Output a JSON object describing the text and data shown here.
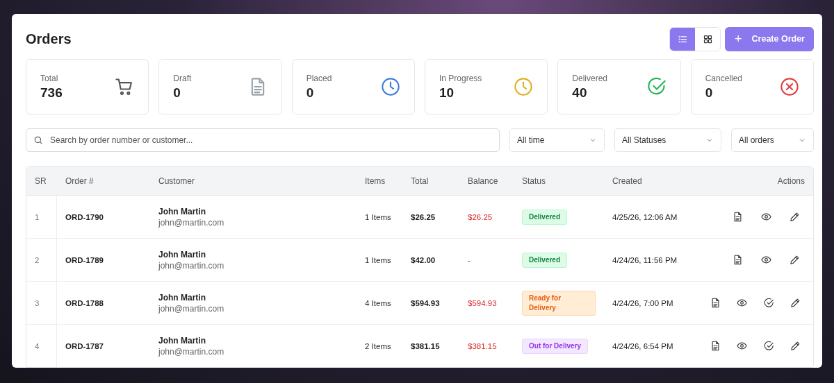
{
  "title": "Orders",
  "view_toggle": [
    {
      "kind": "list",
      "selected": true
    },
    {
      "kind": "grid",
      "selected": false
    }
  ],
  "create_button": {
    "icon": "+",
    "label": "Create Order"
  },
  "stats": [
    {
      "label": "Total",
      "value": "736",
      "kind": "cart",
      "color": "#555555"
    },
    {
      "label": "Draft",
      "value": "0",
      "kind": "document",
      "color": "#9aa0a8"
    },
    {
      "label": "Placed",
      "value": "0",
      "kind": "clock",
      "color": "#3b7ddd"
    },
    {
      "label": "In Progress",
      "value": "10",
      "kind": "clock",
      "color": "#e0b020"
    },
    {
      "label": "Delivered",
      "value": "40",
      "kind": "check",
      "color": "#22b45a"
    },
    {
      "label": "Cancelled",
      "value": "0",
      "kind": "cancel",
      "color": "#e04040"
    }
  ],
  "search": {
    "placeholder": "Search by order number or customer..."
  },
  "filters": [
    {
      "value": "All time"
    },
    {
      "value": "All Statuses"
    },
    {
      "value": "All orders"
    }
  ],
  "table": {
    "columns": [
      "SR",
      "Order #",
      "Customer",
      "Items",
      "Total",
      "Balance",
      "Status",
      "Created",
      "Actions"
    ],
    "rows": [
      {
        "sr": "1",
        "order": "ORD-1790",
        "name": "John Martin",
        "email": "john@martin.com",
        "items": "1 Items",
        "total": "$26.25",
        "balance": "$26.25",
        "outstanding": true,
        "status": {
          "label": "Delivered",
          "kind": "delivered"
        },
        "created": "4/25/26, 12:06 AM",
        "actions": [
          {
            "kind": "document"
          },
          {
            "kind": "view"
          },
          {
            "kind": "edit"
          }
        ]
      },
      {
        "sr": "2",
        "order": "ORD-1789",
        "name": "John Martin",
        "email": "john@martin.com",
        "items": "1 Items",
        "total": "$42.00",
        "balance": "-",
        "outstanding": false,
        "status": {
          "label": "Delivered",
          "kind": "delivered"
        },
        "created": "4/24/26, 11:56 PM",
        "actions": [
          {
            "kind": "document"
          },
          {
            "kind": "view"
          },
          {
            "kind": "edit"
          }
        ]
      },
      {
        "sr": "3",
        "order": "ORD-1788",
        "name": "John Martin",
        "email": "john@martin.com",
        "items": "4 Items",
        "total": "$594.93",
        "balance": "$594.93",
        "outstanding": true,
        "status": {
          "label": "Ready for Delivery",
          "kind": "ready"
        },
        "created": "4/24/26, 7:00 PM",
        "actions": [
          {
            "kind": "document"
          },
          {
            "kind": "view"
          },
          {
            "kind": "approve"
          },
          {
            "kind": "edit"
          }
        ]
      },
      {
        "sr": "4",
        "order": "ORD-1787",
        "name": "John Martin",
        "email": "john@martin.com",
        "items": "2 Items",
        "total": "$381.15",
        "balance": "$381.15",
        "outstanding": true,
        "status": {
          "label": "Out for Delivery",
          "kind": "out"
        },
        "created": "4/24/26, 6:54 PM",
        "actions": [
          {
            "kind": "document"
          },
          {
            "kind": "view"
          },
          {
            "kind": "approve"
          },
          {
            "kind": "edit"
          }
        ]
      }
    ]
  }
}
